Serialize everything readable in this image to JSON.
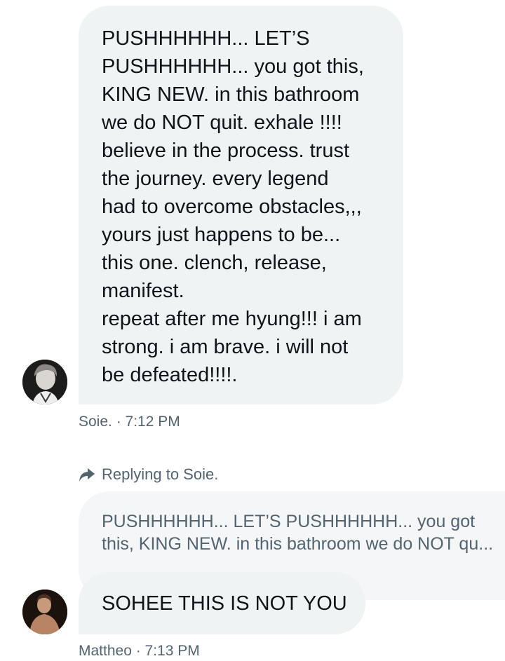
{
  "thread": {
    "message1": {
      "lines": [
        "PUSHHHHHH... LET’S",
        "PUSHHHHHH... you got this,",
        "KING NEW. in this bathroom",
        "we do NOT quit. exhale !!!!",
        "believe in the process. trust",
        "the journey. every legend",
        "had to overcome obstacles,,,",
        "yours just happens to be...",
        "this one. clench, release,",
        "manifest.",
        "repeat after me hyung!!! i am",
        "strong. i am brave. i will not",
        "be defeated!!!!."
      ],
      "meta": "Soie. · 7:12 PM"
    },
    "reply_label": "Replying to Soie.",
    "quoted": {
      "lines": [
        "PUSHHHHHH... LET’S PUSHHHHHH... you got",
        "this, KING NEW. in this bathroom we do NOT qu..."
      ]
    },
    "message2": {
      "text": "SOHEE THIS IS NOT YOU",
      "meta": "Mattheo · 7:13 PM"
    }
  }
}
